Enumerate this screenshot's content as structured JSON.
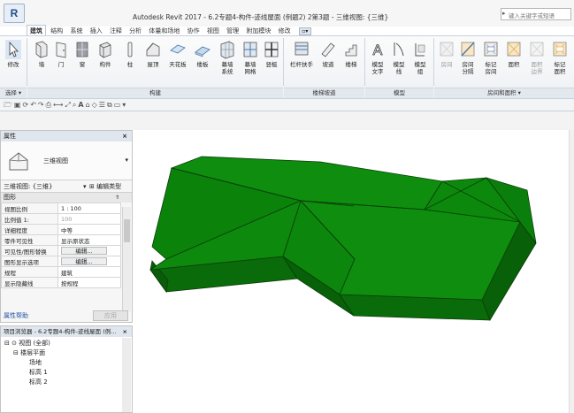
{
  "titlebar": {
    "app_button": "R",
    "title": "Autodesk Revit 2017 -    6.2专题4-构件-迹线屋面 (例题2) 2第3题 - 三维视图: {三维}",
    "search_placeholder": "键入关键字或短语"
  },
  "tabs": [
    {
      "label": "建筑",
      "active": true
    },
    {
      "label": "结构"
    },
    {
      "label": "系统"
    },
    {
      "label": "插入"
    },
    {
      "label": "注释"
    },
    {
      "label": "分析"
    },
    {
      "label": "体量和场地"
    },
    {
      "label": "协作"
    },
    {
      "label": "视图"
    },
    {
      "label": "管理"
    },
    {
      "label": "附加模块"
    },
    {
      "label": "修改"
    }
  ],
  "ribbon": {
    "buttons": [
      {
        "label": "修改",
        "icon": "cursor-arrow-icon"
      },
      {
        "label": "墙",
        "icon": "wall-icon"
      },
      {
        "label": "门",
        "icon": "door-icon"
      },
      {
        "label": "窗",
        "icon": "window-icon"
      },
      {
        "label": "构件",
        "icon": "component-icon"
      },
      {
        "label": "柱",
        "icon": "column-icon"
      },
      {
        "label": "屋顶",
        "icon": "roof-icon"
      },
      {
        "label": "天花板",
        "icon": "ceiling-icon"
      },
      {
        "label": "楼板",
        "icon": "floor-icon"
      },
      {
        "label": "幕墙",
        "label2": "系统",
        "icon": "curtain-system-icon"
      },
      {
        "label": "幕墙",
        "label2": "网格",
        "icon": "curtain-grid-icon"
      },
      {
        "label": "竖梃",
        "icon": "mullion-icon"
      },
      {
        "label": "栏杆扶手",
        "icon": "railing-icon"
      },
      {
        "label": "坡道",
        "icon": "ramp-icon"
      },
      {
        "label": "楼梯",
        "icon": "stair-icon"
      },
      {
        "label": "模型",
        "label2": "文字",
        "icon": "model-text-icon"
      },
      {
        "label": "模型",
        "label2": "线",
        "icon": "model-line-icon"
      },
      {
        "label": "模型",
        "label2": "组",
        "icon": "model-group-icon"
      },
      {
        "label": "房间",
        "icon": "room-icon",
        "dim": true
      },
      {
        "label": "房间",
        "label2": "分隔",
        "icon": "room-separator-icon"
      },
      {
        "label": "标记",
        "label2": "房间",
        "icon": "tag-room-icon"
      },
      {
        "label": "面积",
        "icon": "area-icon"
      },
      {
        "label": "面积",
        "label2": "边界",
        "icon": "area-boundary-icon",
        "dim": true
      },
      {
        "label": "标记",
        "label2": "面积",
        "icon": "tag-area-icon"
      }
    ],
    "groups": [
      "选择 ▾",
      "构建",
      "楼梯坡道",
      "模型",
      "房间和面积 ▾"
    ]
  },
  "properties": {
    "header": "属性",
    "type_name": "三维视图",
    "instance_selector": "三维视图: {三维}",
    "edit_type": "编辑类型",
    "group": "图形",
    "rows": [
      {
        "key": "视图比例",
        "value": "1 : 100"
      },
      {
        "key": "比例值 1:",
        "value": "100",
        "dim": true
      },
      {
        "key": "详细程度",
        "value": "中等"
      },
      {
        "key": "零件可见性",
        "value": "显示原状态"
      },
      {
        "key": "可见性/图形替换",
        "value": "编辑...",
        "button": true
      },
      {
        "key": "图形显示选项",
        "value": "编辑...",
        "button": true
      },
      {
        "key": "规程",
        "value": "建筑"
      },
      {
        "key": "显示隐藏线",
        "value": "按规程"
      }
    ],
    "help_link": "属性帮助",
    "apply_button": "应用"
  },
  "project_browser": {
    "header": "项目浏览器 - 6.2专题4-构件-迹线屋面 (例...",
    "root": "视图 (全部)",
    "nodes": [
      "楼层平面",
      "场地",
      "标高 1",
      "标高 2"
    ]
  },
  "colors": {
    "roof_top": "#0d8a0d",
    "roof_side": "#0a6b0a",
    "edge": "#0a3d0a"
  }
}
